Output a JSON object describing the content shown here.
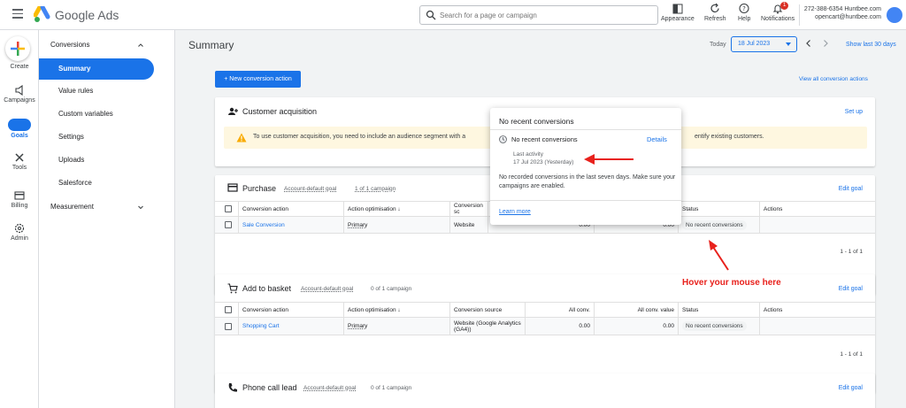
{
  "app": {
    "name": "Google Ads"
  },
  "search": {
    "placeholder": "Search for a page or campaign"
  },
  "toolbar": {
    "appearance": "Appearance",
    "refresh": "Refresh",
    "help": "Help",
    "notifications": "Notifications",
    "notification_count": "1"
  },
  "account": {
    "id": "272-388-6354 Huntbee.com",
    "email": "opencart@huntbee.com"
  },
  "rail": {
    "create": "Create",
    "campaigns": "Campaigns",
    "goals": "Goals",
    "tools": "Tools",
    "billing": "Billing",
    "admin": "Admin"
  },
  "subnav": {
    "conversions": "Conversions",
    "summary": "Summary",
    "value_rules": "Value rules",
    "custom_variables": "Custom variables",
    "settings": "Settings",
    "uploads": "Uploads",
    "salesforce": "Salesforce",
    "measurement": "Measurement"
  },
  "main": {
    "title": "Summary",
    "date_label": "Today",
    "date_value": "18 Jul 2023",
    "show_last": "Show last 30 days",
    "new_conversion": "+ New conversion action",
    "view_all": "View all conversion actions"
  },
  "customer_acquisition": {
    "title": "Customer acquisition",
    "setup": "Set up",
    "warning_part1": "To use customer acquisition, you need to include an audience segment with a",
    "warning_part2": "entify existing customers."
  },
  "purchase": {
    "title": "Purchase",
    "goal_type": "Account-default goal",
    "campaigns": "1 of 1 campaign",
    "edit": "Edit goal",
    "columns": {
      "action": "Conversion action",
      "optimisation": "Action optimisation",
      "source": "Conversion sc",
      "status": "Status",
      "actions": "Actions"
    },
    "row": {
      "action": "Sale Conversion",
      "optimisation": "Primary",
      "source": "Website",
      "all_conv": "0.00",
      "value": "0.00",
      "status": "No recent conversions"
    },
    "pager": "1 - 1 of 1"
  },
  "basket": {
    "title": "Add to basket",
    "goal_type": "Account-default goal",
    "campaigns": "0 of 1 campaign",
    "edit": "Edit goal",
    "columns": {
      "action": "Conversion action",
      "optimisation": "Action optimisation",
      "source": "Conversion source",
      "all_conv": "All conv.",
      "value": "All conv. value",
      "status": "Status",
      "actions": "Actions"
    },
    "row": {
      "action": "Shopping Cart",
      "optimisation": "Primary",
      "source": "Website (Google Analytics (GA4))",
      "all_conv": "0.00",
      "value": "0.00",
      "status": "No recent conversions"
    },
    "pager": "1 - 1 of 1"
  },
  "phone": {
    "title": "Phone call lead",
    "goal_type": "Account-default goal",
    "campaigns": "0 of 1 campaign",
    "edit": "Edit goal"
  },
  "popup": {
    "title": "No recent conversions",
    "subtitle": "No recent conversions",
    "details": "Details",
    "last_activity_label": "Last activity",
    "last_activity_value": "17 Jul 2023 (Yesterday)",
    "body": "No recorded conversions in the last seven days. Make sure your campaigns are enabled.",
    "learn_more": "Learn more"
  },
  "annotation": {
    "text": "Hover your mouse here"
  },
  "colors": {
    "accent": "#1a73e8",
    "annotation": "#e8211c",
    "warning_bg": "#fef7e0"
  }
}
